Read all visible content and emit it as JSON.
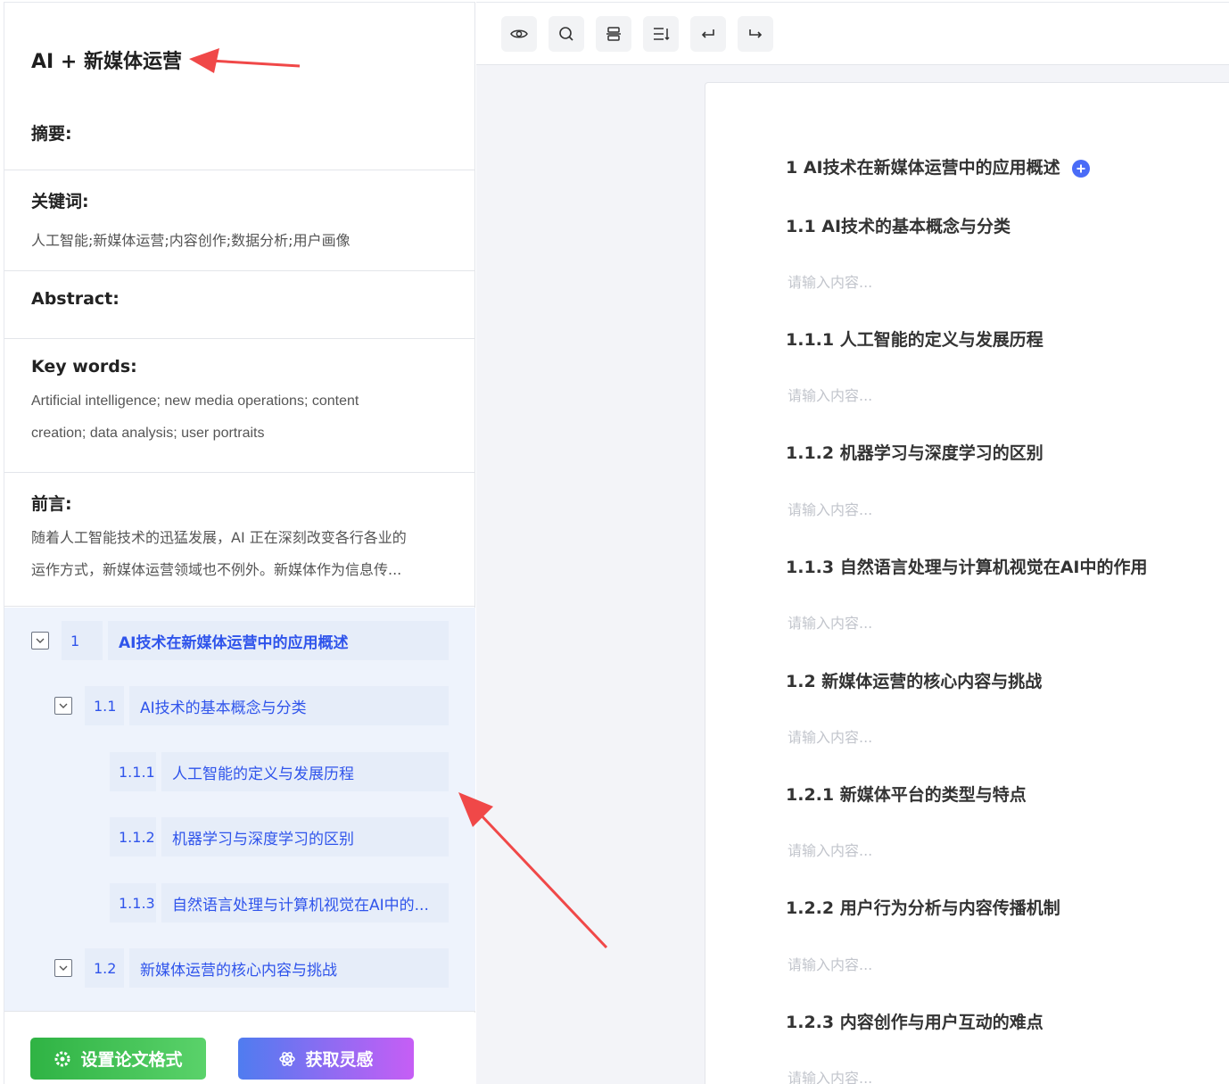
{
  "paper": {
    "title": "AI + 新媒体运营",
    "abstract_label": "摘要:",
    "keywords_label": "关键词:",
    "keywords": "人工智能;新媒体运营;内容创作;数据分析;用户画像",
    "abstract_en_label": "Abstract:",
    "keywords_en_label": "Key words:",
    "keywords_en_line1": "Artificial intelligence; new media operations; content",
    "keywords_en_line2": "creation; data analysis; user portraits",
    "preface_label": "前言:",
    "preface_line1": "随着人工智能技术的迅猛发展，AI 正在深刻改变各行各业的",
    "preface_line2": "运作方式，新媒体运营领域也不例外。新媒体作为信息传..."
  },
  "outline": [
    {
      "num": "1",
      "title": "AI技术在新媒体运营中的应用概述"
    },
    {
      "num": "1.1",
      "title": "AI技术的基本概念与分类"
    },
    {
      "num": "1.1.1",
      "title": "人工智能的定义与发展历程"
    },
    {
      "num": "1.1.2",
      "title": "机器学习与深度学习的区别"
    },
    {
      "num": "1.1.3",
      "title": "自然语言处理与计算机视觉在AI中的..."
    },
    {
      "num": "1.2",
      "title": "新媒体运营的核心内容与挑战"
    }
  ],
  "buttons": {
    "format": "设置论文格式",
    "inspire": "获取灵感"
  },
  "toolbar": [
    "preview-icon",
    "search-icon",
    "layout-icon",
    "list-icon",
    "undo-icon",
    "redo-icon"
  ],
  "document": {
    "placeholder": "请输入内容...",
    "headings": [
      "1 AI技术在新媒体运营中的应用概述",
      "1.1 AI技术的基本概念与分类",
      "1.1.1 人工智能的定义与发展历程",
      "1.1.2 机器学习与深度学习的区别",
      "1.1.3 自然语言处理与计算机视觉在AI中的作用",
      "1.2 新媒体运营的核心内容与挑战",
      "1.2.1 新媒体平台的类型与特点",
      "1.2.2 用户行为分析与内容传播机制",
      "1.2.3 内容创作与用户互动的难点"
    ]
  },
  "colors": {
    "accent": "#2f54eb",
    "outline_bg": "#eef3fc",
    "annotation_arrow": "#f04848"
  }
}
